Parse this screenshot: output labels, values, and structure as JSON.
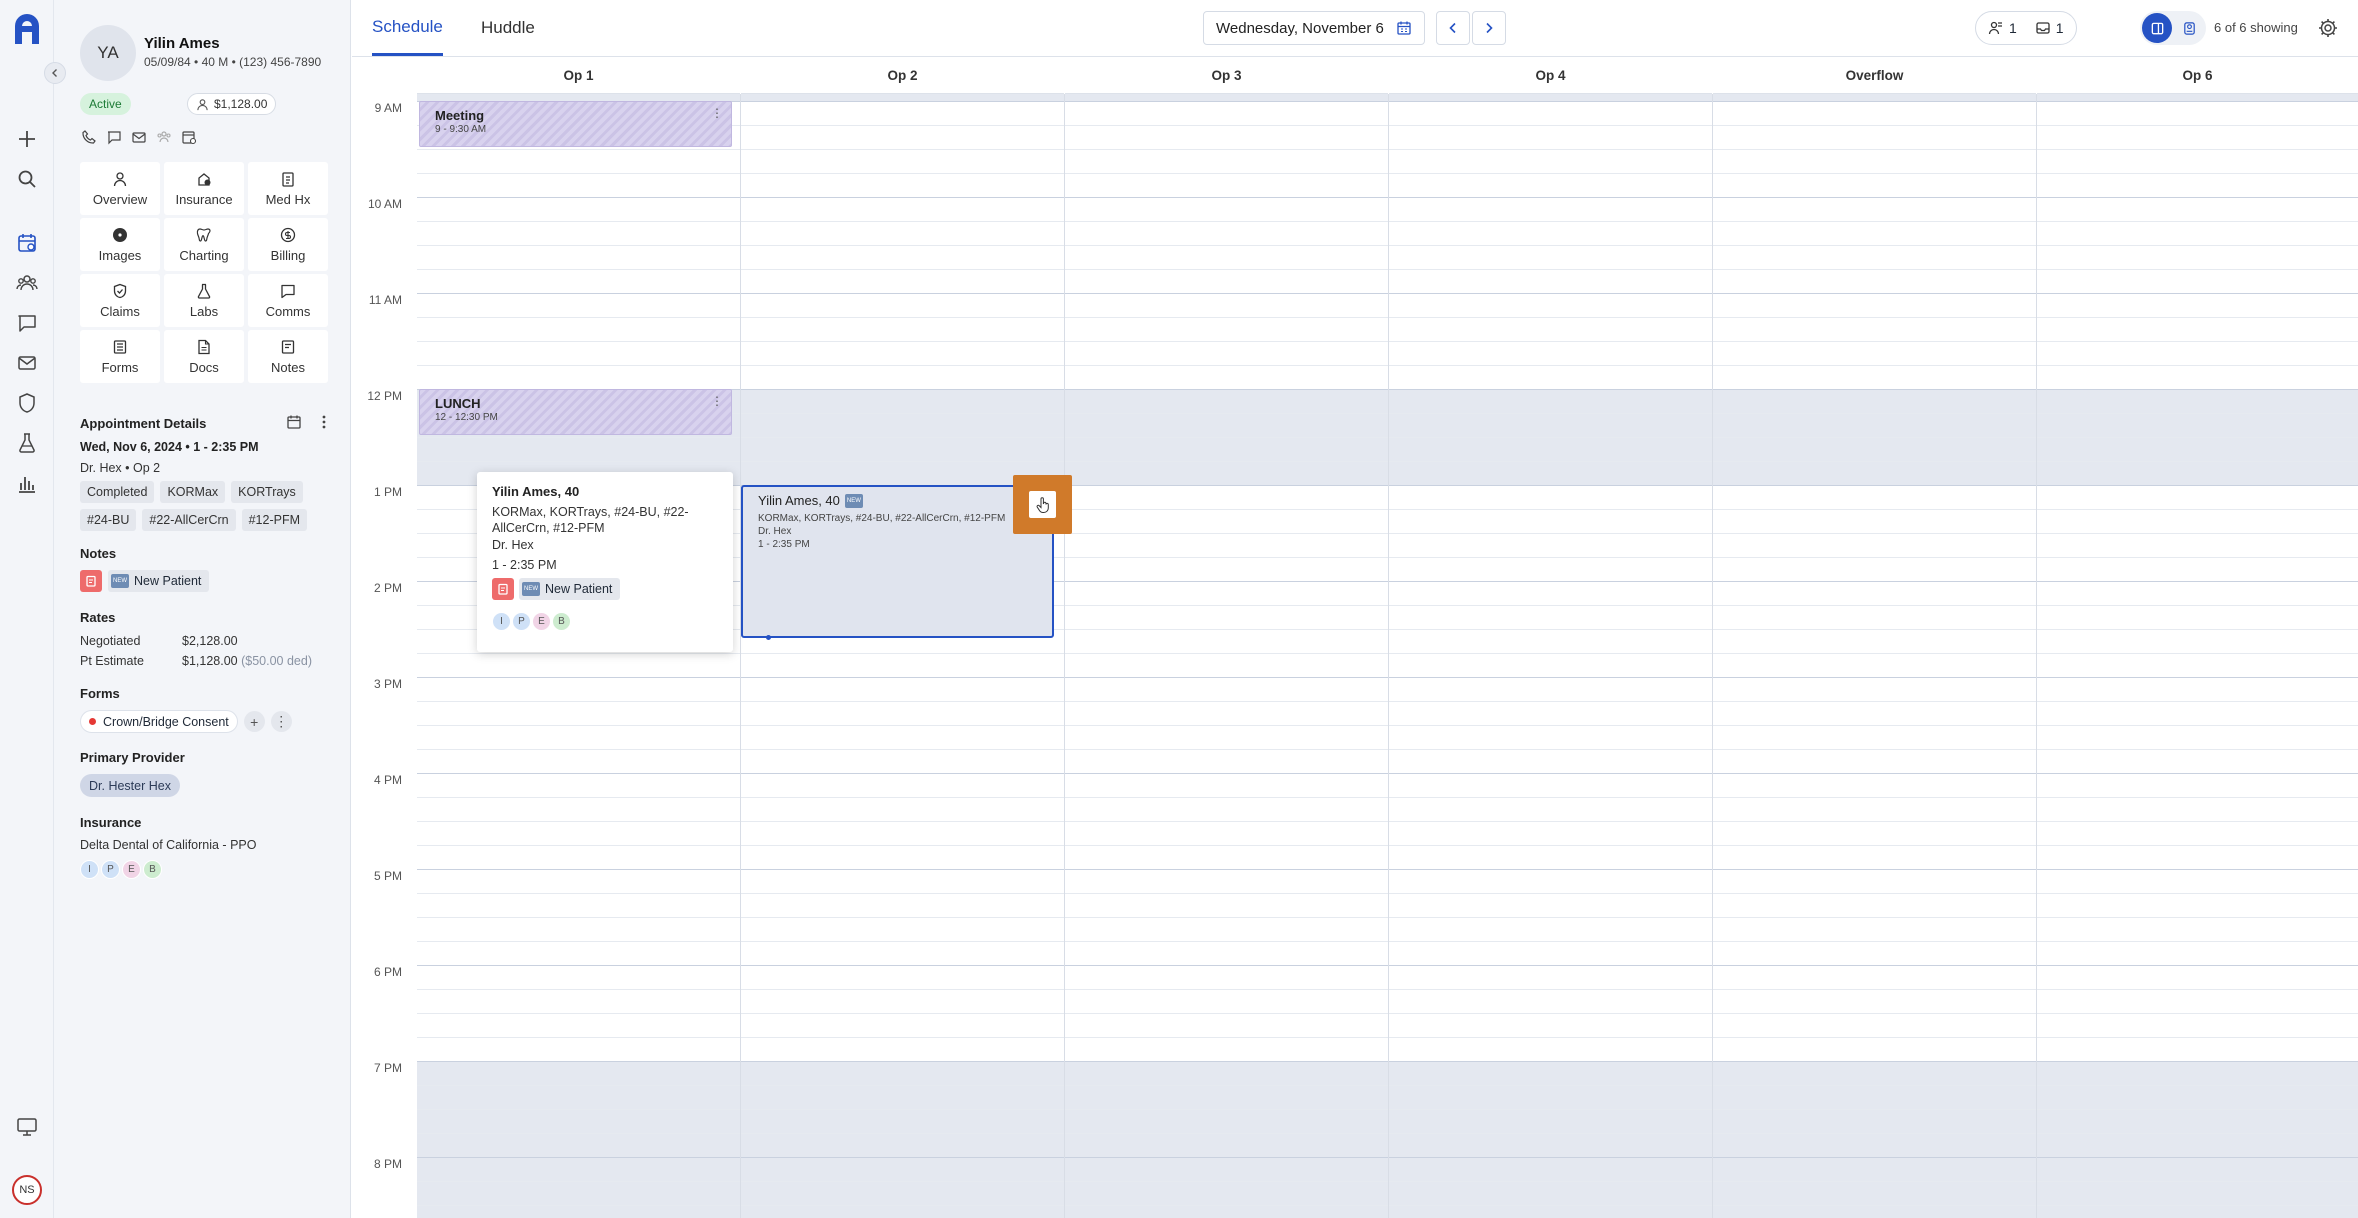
{
  "patient": {
    "initials": "YA",
    "name": "Yilin Ames",
    "info": "05/09/84 • 40 M • (123) 456-7890",
    "status": "Active",
    "balance": "$1,128.00"
  },
  "tiles": [
    {
      "label": "Overview",
      "icon": "person-icon"
    },
    {
      "label": "Insurance",
      "icon": "insurance-icon"
    },
    {
      "label": "Med Hx",
      "icon": "clipboard-icon"
    },
    {
      "label": "Images",
      "icon": "radiation-icon"
    },
    {
      "label": "Charting",
      "icon": "tooth-icon"
    },
    {
      "label": "Billing",
      "icon": "billing-icon"
    },
    {
      "label": "Claims",
      "icon": "shield-check-icon"
    },
    {
      "label": "Labs",
      "icon": "flask-icon"
    },
    {
      "label": "Comms",
      "icon": "chat-icon"
    },
    {
      "label": "Forms",
      "icon": "forms-icon"
    },
    {
      "label": "Docs",
      "icon": "doc-icon"
    },
    {
      "label": "Notes",
      "icon": "notes-icon"
    }
  ],
  "appointment": {
    "title": "Appointment Details",
    "date": "Wed, Nov 6, 2024 • 1 - 2:35 PM",
    "provider_op": "Dr. Hex • Op 2",
    "chips": [
      "Completed",
      "KORMax",
      "KORTrays",
      "#24-BU",
      "#22-AllCerCrn",
      "#12-PFM"
    ]
  },
  "notes": {
    "title": "Notes",
    "tag": "NEW",
    "label": "New Patient"
  },
  "rates": {
    "title": "Rates",
    "negotiated_label": "Negotiated",
    "negotiated_value": "$2,128.00",
    "estimate_label": "Pt Estimate",
    "estimate_value": "$1,128.00",
    "estimate_ded": "($50.00 ded)"
  },
  "forms": {
    "title": "Forms",
    "item": "Crown/Bridge Consent",
    "add": "+",
    "more": "⋮"
  },
  "primary_provider": {
    "title": "Primary Provider",
    "name": "Dr. Hester Hex"
  },
  "insurance": {
    "title": "Insurance",
    "name": "Delta Dental of California - PPO",
    "circles": [
      "I",
      "P",
      "E",
      "B"
    ]
  },
  "user_initials": "NS",
  "header": {
    "tabs": [
      "Schedule",
      "Huddle"
    ],
    "date": "Wednesday, November 6",
    "count_a": "1",
    "count_b": "1",
    "showing": "6 of 6 showing"
  },
  "ops": [
    "Op 1",
    "Op 2",
    "Op 3",
    "Op 4",
    "Overflow",
    "Op 6"
  ],
  "times": [
    "9 AM",
    "10 AM",
    "11 AM",
    "12 PM",
    "1 PM",
    "2 PM",
    "3 PM",
    "4 PM",
    "5 PM",
    "6 PM",
    "7 PM",
    "8 PM"
  ],
  "events": {
    "meeting": {
      "title": "Meeting",
      "time": "9 - 9:30 AM"
    },
    "lunch": {
      "title": "LUNCH",
      "time": "12 - 12:30 PM"
    }
  },
  "appt_card": {
    "name": "Yilin Ames, 40",
    "tag": "NEW",
    "procedures": "KORMax, KORTrays, #24-BU, #22-AllCerCrn, #12-PFM",
    "provider": "Dr. Hex",
    "time": "1 - 2:35 PM"
  },
  "popup": {
    "name": "Yilin Ames, 40",
    "procedures": "KORMax, KORTrays, #24-BU, #22-AllCerCrn, #12-PFM",
    "provider": "Dr. Hex",
    "time": "1 - 2:35 PM",
    "tag": "NEW",
    "note": "New Patient",
    "circles": [
      "I",
      "P",
      "E",
      "B"
    ]
  }
}
